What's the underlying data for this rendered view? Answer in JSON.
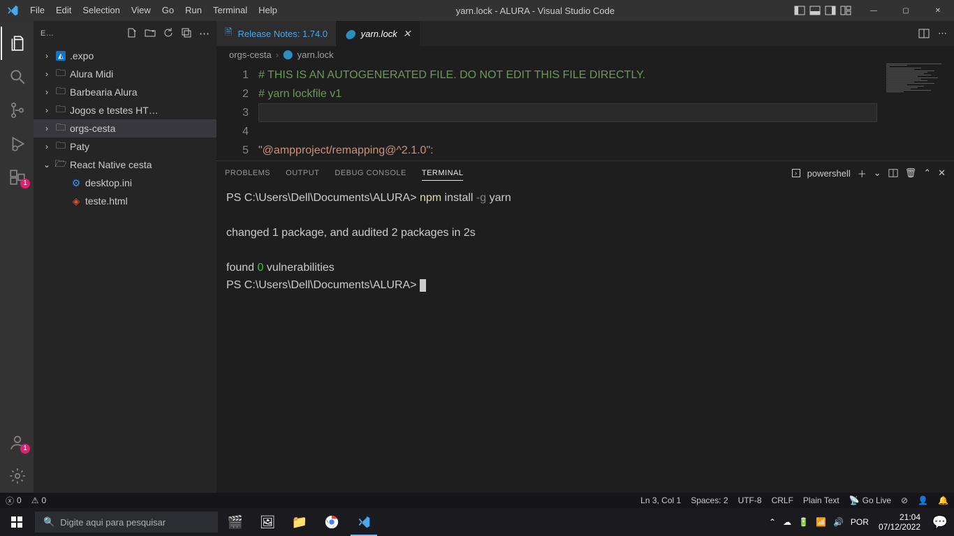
{
  "window": {
    "title": "yarn.lock - ALURA - Visual Studio Code"
  },
  "menu": [
    "File",
    "Edit",
    "Selection",
    "View",
    "Go",
    "Run",
    "Terminal",
    "Help"
  ],
  "activitybar": {
    "ext_badge": "1",
    "account_badge": "1"
  },
  "sidebar": {
    "header_label": "E…",
    "items": [
      {
        "chev": "›",
        "icon": "expo",
        "label": ".expo"
      },
      {
        "chev": "›",
        "icon": "folder",
        "label": "Alura Midi"
      },
      {
        "chev": "›",
        "icon": "folder",
        "label": "Barbearia Alura"
      },
      {
        "chev": "›",
        "icon": "folder",
        "label": "Jogos e testes HT…"
      },
      {
        "chev": "›",
        "icon": "folder",
        "label": "orgs-cesta",
        "selected": true
      },
      {
        "chev": "›",
        "icon": "folder",
        "label": "Paty"
      },
      {
        "chev": "⌄",
        "icon": "folder-open",
        "label": "React Native cesta"
      },
      {
        "chev": "",
        "icon": "gear",
        "label": "desktop.ini",
        "indent": true
      },
      {
        "chev": "",
        "icon": "html",
        "label": "teste.html",
        "indent": true
      }
    ]
  },
  "tabs": {
    "release": "Release Notes: 1.74.0",
    "active": "yarn.lock"
  },
  "breadcrumbs": {
    "a": "orgs-cesta",
    "b": "yarn.lock"
  },
  "editor": {
    "lines": {
      "1": "# THIS IS AN AUTOGENERATED FILE. DO NOT EDIT THIS FILE DIRECTLY.",
      "2": "# yarn lockfile v1",
      "5": "\"@ampproject/remapping@^2.1.0\":"
    }
  },
  "panel": {
    "tabs": {
      "problems": "PROBLEMS",
      "output": "OUTPUT",
      "debug": "DEBUG CONSOLE",
      "terminal": "TERMINAL"
    },
    "shell": "powershell"
  },
  "terminal": {
    "prompt1": "PS C:\\Users\\Dell\\Documents\\ALURA> ",
    "cmd_npm": "npm",
    "cmd_install": " install ",
    "cmd_g": "-g",
    "cmd_yarn": " yarn",
    "line2": "changed 1 package, and audited 2 packages in 2s",
    "found_pre": "found ",
    "found_zero": "0",
    "found_post": " vulnerabilities",
    "prompt2": "PS C:\\Users\\Dell\\Documents\\ALURA> "
  },
  "status": {
    "errors": "0",
    "warnings": "0",
    "ln": "Ln 3, Col 1",
    "spaces": "Spaces: 2",
    "enc": "UTF-8",
    "eol": "CRLF",
    "lang": "Plain Text",
    "golive": "Go Live"
  },
  "taskbar": {
    "search_placeholder": "Digite aqui para pesquisar",
    "lang": "POR",
    "time": "21:04",
    "date": "07/12/2022"
  }
}
